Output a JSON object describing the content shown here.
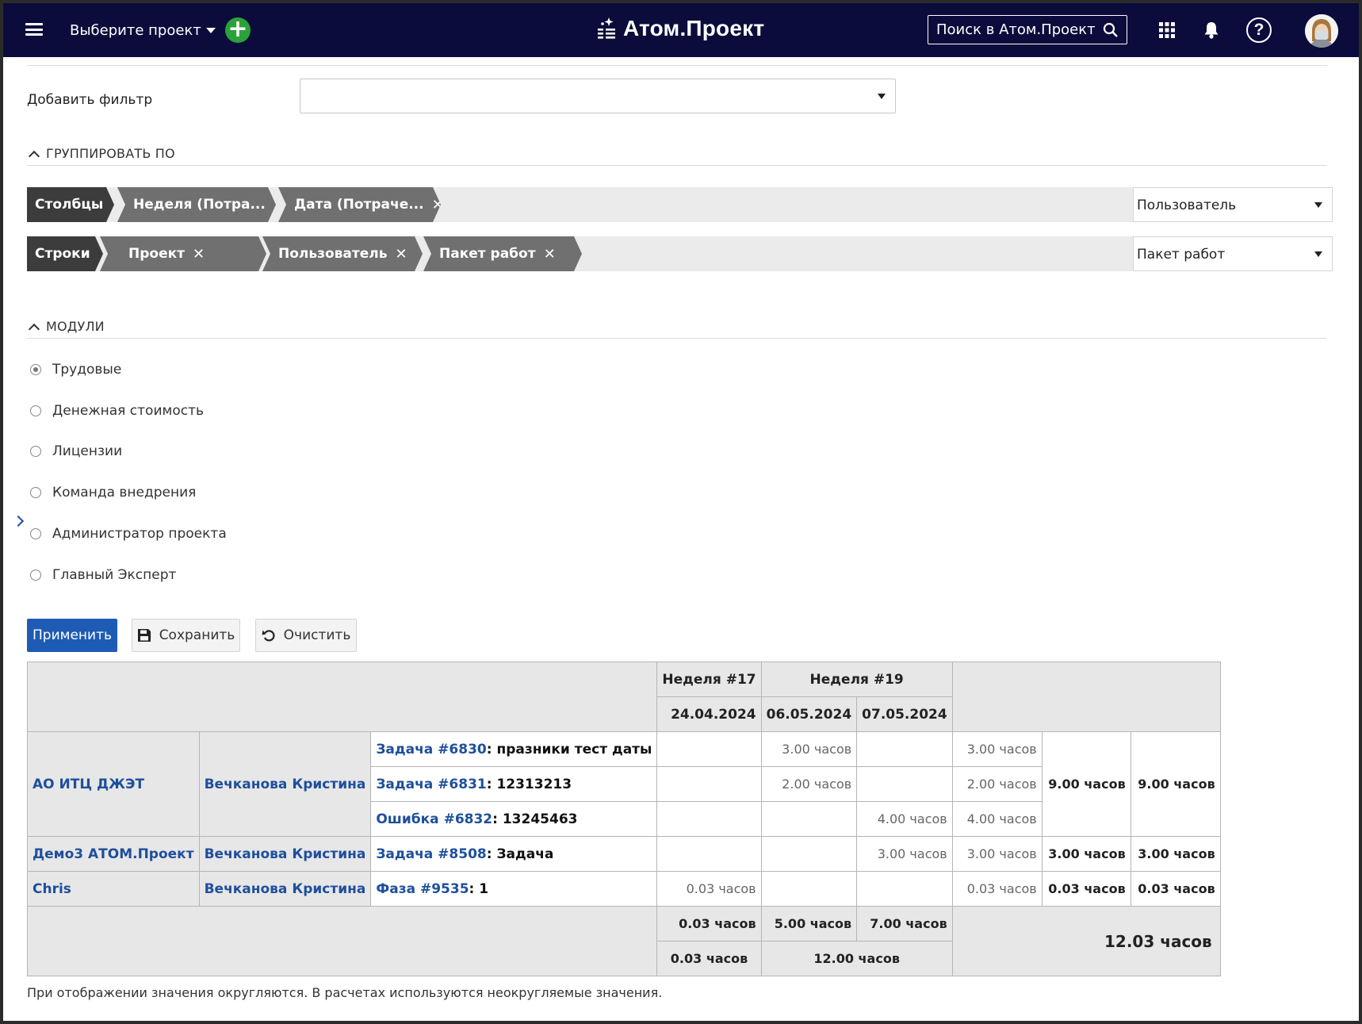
{
  "header": {
    "project_select": "Выберите проект",
    "logo_text": "Атом.Проект",
    "search_placeholder": "Поиск в Атом.Проект",
    "icons": [
      "menu-icon",
      "plus-icon",
      "search-icon",
      "apps-grid-icon",
      "bell-icon",
      "help-icon",
      "avatar"
    ],
    "colors": {
      "bar": "#0b0c3c",
      "add_button": "#2aa23a"
    }
  },
  "filters": {
    "add_filter_label": "Добавить фильтр",
    "add_filter_value": ""
  },
  "group_by": {
    "title": "ГРУППИРОВАТЬ ПО",
    "columns": {
      "label": "Столбцы",
      "items": [
        "Неделя (Потра...",
        "Дата (Потраче..."
      ],
      "select_value": "Пользователь"
    },
    "rows": {
      "label": "Строки",
      "items": [
        "Проект",
        "Пользователь",
        "Пакет работ"
      ],
      "select_value": "Пакет работ"
    }
  },
  "modules": {
    "title": "МОДУЛИ",
    "options": [
      {
        "label": "Трудовые",
        "checked": true
      },
      {
        "label": "Денежная стоимость",
        "checked": false
      },
      {
        "label": "Лицензии",
        "checked": false
      },
      {
        "label": "Команда внедрения",
        "checked": false
      },
      {
        "label": "Администратор проекта",
        "checked": false
      },
      {
        "label": "Главный Эксперт",
        "checked": false
      }
    ]
  },
  "actions": {
    "apply": "Применить",
    "save": "Сохранить",
    "clear": "Очистить",
    "apply_color": "#1e5bb5"
  },
  "report": {
    "weeks": [
      "Неделя #17",
      "Неделя #19"
    ],
    "dates": [
      "24.04.2024",
      "06.05.2024",
      "07.05.2024"
    ],
    "rows": [
      {
        "project": "АО ИТЦ ДЖЭТ",
        "user": "Вечканова Кристина",
        "wp_link": "Задача #6830",
        "wp_name": ": празники тест даты",
        "d1": "",
        "d2": "3.00 часов",
        "d3": "",
        "row_total": "3.00 часов"
      },
      {
        "project": "",
        "user": "",
        "wp_link": "Задача #6831",
        "wp_name": ": 12313213",
        "d1": "",
        "d2": "2.00 часов",
        "d3": "",
        "row_total": "2.00 часов"
      },
      {
        "project": "",
        "user": "",
        "wp_link": "Ошибка #6832",
        "wp_name": ": 13245463",
        "d1": "",
        "d2": "",
        "d3": "4.00 часов",
        "row_total": "4.00 часов"
      },
      {
        "project": "Демо3 АТОМ.Проект",
        "user": "Вечканова Кристина",
        "wp_link": "Задача #8508",
        "wp_name": ": Задача",
        "d1": "",
        "d2": "",
        "d3": "3.00 часов",
        "row_total": "3.00 часов"
      },
      {
        "project": "Chris",
        "user": "Вечканова Кристина",
        "wp_link": "Фаза #9535",
        "wp_name": ": 1",
        "d1": "0.03 часов",
        "d2": "",
        "d3": "",
        "row_total": "0.03 часов"
      }
    ],
    "group_totals": {
      "itc_user": "9.00 часов",
      "itc_project": "9.00 часов",
      "demo_user": "3.00 часов",
      "demo_project": "3.00 часов",
      "chris_user": "0.03 часов",
      "chris_project": "0.03 часов"
    },
    "date_totals": [
      "0.03 часов",
      "5.00 часов",
      "7.00 часов"
    ],
    "week_totals": [
      "0.03 часов",
      "12.00 часов"
    ],
    "grand_total": "12.03 часов"
  },
  "footnote": "При отображении значения округляются. В расчетах используются неокругляемые значения."
}
